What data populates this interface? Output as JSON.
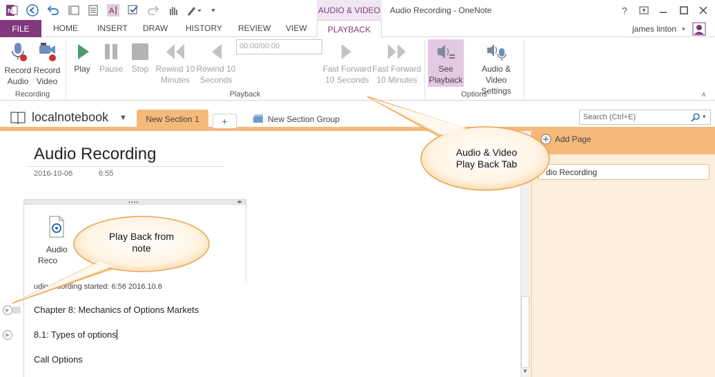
{
  "window": {
    "title": "Audio Recording - OneNote",
    "contextual_tab": "AUDIO & VIDEO",
    "help_icon": "?",
    "user_name": "james linton"
  },
  "tabs": {
    "file": "FILE",
    "home": "HOME",
    "insert": "INSERT",
    "draw": "DRAW",
    "history": "HISTORY",
    "review": "REVIEW",
    "view": "VIEW",
    "playback": "PLAYBACK"
  },
  "ribbon": {
    "recording_group": {
      "label": "Recording",
      "record_audio_1": "Record",
      "record_audio_2": "Audio",
      "record_video_1": "Record",
      "record_video_2": "Video"
    },
    "playback_group": {
      "label": "Playback",
      "play": "Play",
      "pause": "Pause",
      "stop": "Stop",
      "rewind10m_1": "Rewind 10",
      "rewind10m_2": "Minutes",
      "rewind10s_1": "Rewind 10",
      "rewind10s_2": "Seconds",
      "time_value": "00:00/00:00",
      "ff10s_1": "Fast Forward",
      "ff10s_2": "10 Seconds",
      "ff10m_1": "Fast Forward",
      "ff10m_2": "10 Minutes"
    },
    "options_group": {
      "label": "Options",
      "see_playback_1": "See",
      "see_playback_2": "Playback",
      "av_settings_1": "Audio &",
      "av_settings_2": "Video Settings"
    }
  },
  "notebook": {
    "name": "localnotebook",
    "section_tab": "New Section 1",
    "add_section": "+",
    "section_group": "New Section Group",
    "search_placeholder": "Search (Ctrl+E)"
  },
  "page": {
    "title": "Audio Recording",
    "date": "2016-10-06",
    "time": "6:55",
    "audio_label_1": "Audio",
    "audio_label_2": "Reco",
    "recording_started": "udio recording started: 6:56 2016.10.6",
    "line1": "Chapter 8: Mechanics of Options Markets",
    "line2": "8.1: Types of options",
    "line3": "Call Options"
  },
  "page_panel": {
    "add_page": "Add Page",
    "page_item": "dio Recording"
  },
  "callouts": {
    "tab_callout_1": "Audio & Video",
    "tab_callout_2": "Play Back Tab",
    "note_callout_1": "Play Back from",
    "note_callout_2": "note"
  },
  "colors": {
    "accent_purple": "#80397b",
    "section_orange": "#f5b97c",
    "page_panel_bg": "#fdeedd",
    "play_green": "#4e9a6f"
  },
  "icons": [
    "onenote-logo-icon",
    "back-icon",
    "undo-icon",
    "dock-icon",
    "page-icon",
    "text-select-icon",
    "check-icon",
    "redo-icon",
    "hand-icon",
    "pen-icon",
    "minimize-icon",
    "restore-icon",
    "maximize-icon",
    "close-icon",
    "mic-record-icon",
    "video-record-icon",
    "play-icon",
    "pause-icon",
    "stop-icon",
    "rewind-icon",
    "fast-forward-icon",
    "speaker-list-icon",
    "speaker-mic-icon",
    "notebook-icon",
    "search-icon",
    "add-page-icon",
    "audio-file-icon"
  ]
}
